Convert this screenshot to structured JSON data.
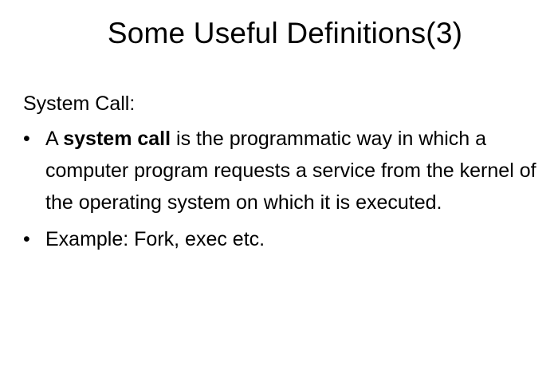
{
  "slide": {
    "title": "Some Useful Definitions(3)",
    "section_label": "System Call:",
    "bullet_symbol": "•",
    "bullets": [
      {
        "lead": " A ",
        "term": "system call",
        "rest": " is the programmatic way in which a computer program requests a service from the kernel of the operating system on which it is executed."
      },
      {
        "text": "Example: Fork, exec etc."
      }
    ]
  }
}
